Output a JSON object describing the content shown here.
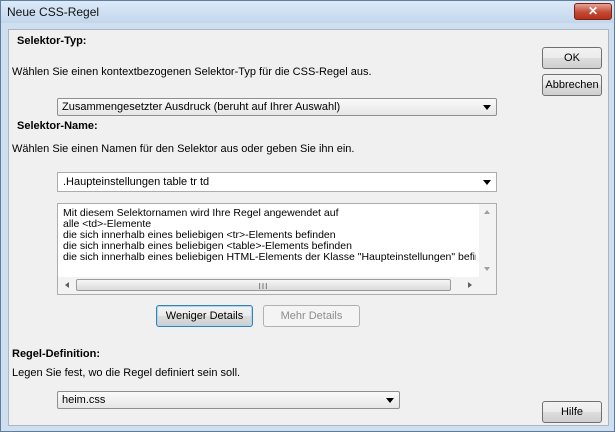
{
  "window": {
    "title": "Neue CSS-Regel",
    "close_glyph": "✕"
  },
  "selector_type": {
    "heading": "Selektor-Typ:",
    "instruction": "Wählen Sie einen kontextbezogenen Selektor-Typ für die CSS-Regel aus.",
    "value": "Zusammengesetzter Ausdruck (beruht auf Ihrer Auswahl)"
  },
  "selector_name": {
    "heading": "Selektor-Name:",
    "instruction": "Wählen Sie einen Namen für den Selektor aus oder geben Sie ihn ein.",
    "value": ".Haupteinstellungen table tr td",
    "description_lines": [
      "Mit diesem Selektornamen wird Ihre Regel angewendet auf",
      "alle <td>-Elemente",
      "die sich innerhalb eines beliebigen <tr>-Elements befinden",
      "die sich innerhalb eines beliebigen <table>-Elements befinden",
      "die sich innerhalb eines beliebigen HTML-Elements der Klasse \"Haupteinstellungen\" befinden"
    ],
    "scroll_grip": "III"
  },
  "details_buttons": {
    "less": "Weniger Details",
    "more": "Mehr Details"
  },
  "rule_definition": {
    "heading": "Regel-Definition:",
    "instruction": "Legen Sie fest, wo die Regel definiert sein soll.",
    "value": "heim.css"
  },
  "buttons": {
    "ok": "OK",
    "cancel": "Abbrechen",
    "help": "Hilfe"
  }
}
